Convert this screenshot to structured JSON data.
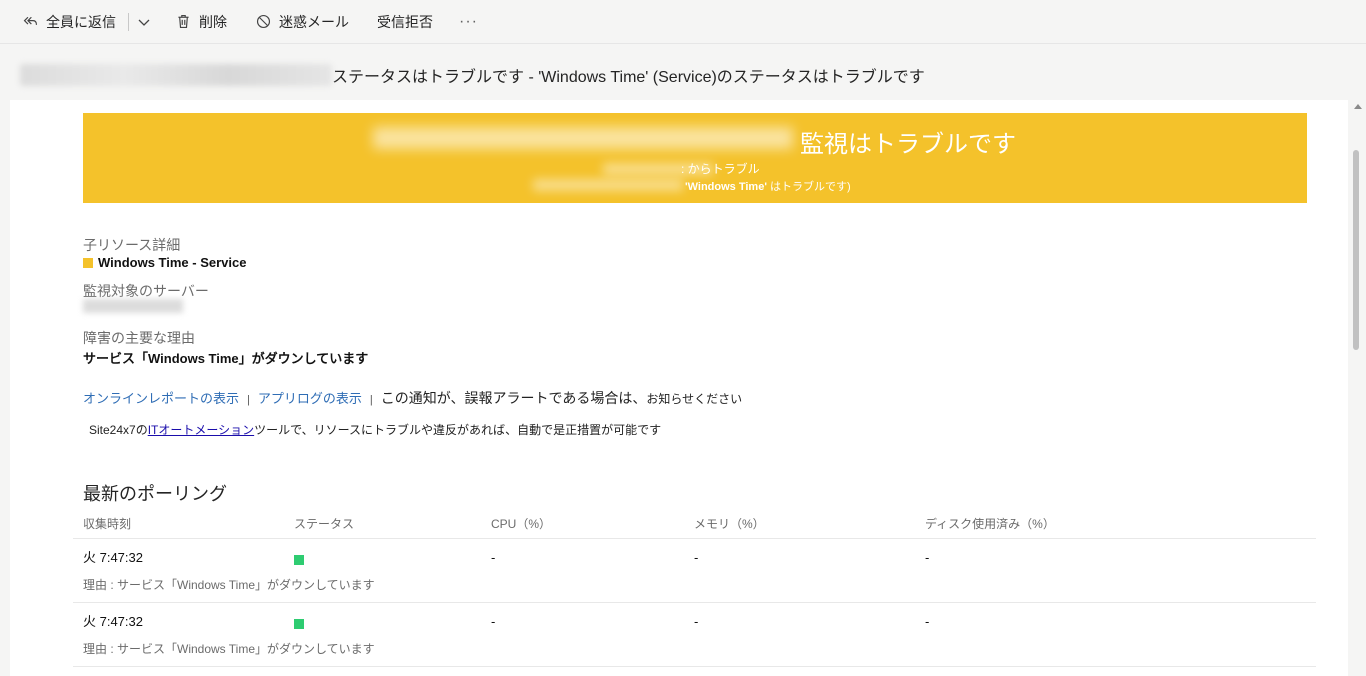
{
  "toolbar": {
    "reply_all": "全員に返信",
    "delete": "削除",
    "junk": "迷惑メール",
    "block": "受信拒否",
    "more": "···"
  },
  "subject": {
    "text": "ステータスはトラブルです - 'Windows Time' (Service)のステータスはトラブルです"
  },
  "banner": {
    "title": "監視はトラブルです",
    "line2": ": からトラブル",
    "line3_bold": "'Windows Time'",
    "line3_rest": " はトラブルです)",
    "color": "#f4c22b"
  },
  "details": {
    "child_resource_label": "子リソース詳細",
    "child_resource_value": "Windows Time - Service",
    "server_label": "監視対象のサーバー",
    "reason_label": "障害の主要な理由",
    "reason_value": "サービス「Windows Time」がダウンしています"
  },
  "links": {
    "online_report": "オンラインレポートの表示",
    "app_log": "アプリログの表示",
    "false_alarm_main": "この通知が、誤報アラートである場合は、",
    "false_alarm_tail": "お知らせください"
  },
  "automation": {
    "prefix": "Site24x7の",
    "link": "ITオートメーション",
    "suffix": "ツールで、リソースにトラブルや違反があれば、自動で是正措置が可能です"
  },
  "polling": {
    "title": "最新のポーリング",
    "headers": [
      "収集時刻",
      "ステータス",
      "CPU（%）",
      "メモリ（%）",
      "ディスク使用済み（%）"
    ],
    "rows": [
      {
        "time": "火 7:47:32",
        "cpu": "-",
        "memory": "-",
        "disk": "-",
        "reason": "理由 : サービス「Windows Time」がダウンしています"
      },
      {
        "time": "火 7:47:32",
        "cpu": "-",
        "memory": "-",
        "disk": "-",
        "reason": "理由 : サービス「Windows Time」がダウンしています"
      }
    ],
    "status_color": "#2ecc71"
  }
}
